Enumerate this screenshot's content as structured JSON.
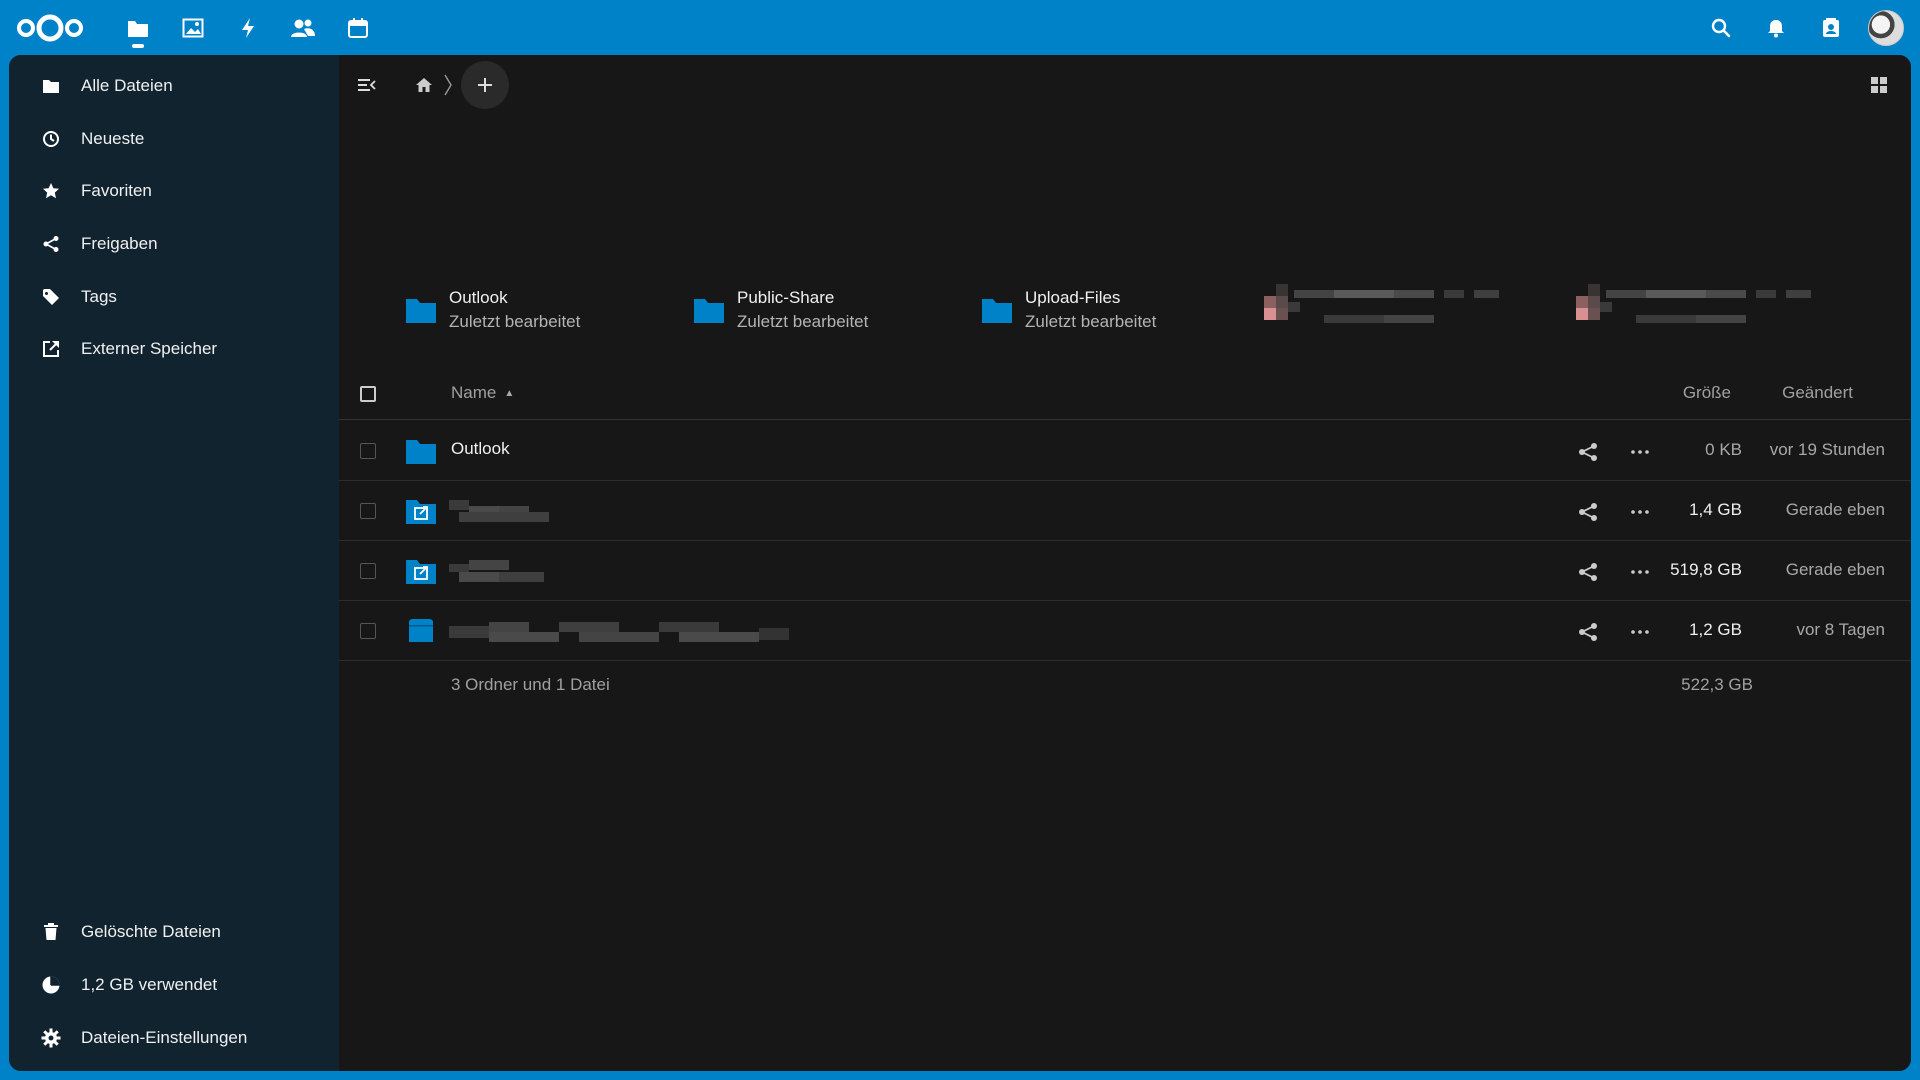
{
  "colors": {
    "primary": "#0082c9",
    "nav_bg": "#11232f",
    "main_bg": "#171717",
    "folder": "#0082c9"
  },
  "header": {
    "apps": [
      {
        "name": "files-icon",
        "active": true
      },
      {
        "name": "photos-icon"
      },
      {
        "name": "activity-icon"
      },
      {
        "name": "contacts-icon"
      },
      {
        "name": "calendar-icon"
      }
    ],
    "right_icons": [
      "search-icon",
      "bell-icon",
      "contacts-menu-icon"
    ]
  },
  "nav": {
    "items": [
      {
        "label": "Alle Dateien",
        "icon": "folder-icon"
      },
      {
        "label": "Neueste",
        "icon": "clock-icon"
      },
      {
        "label": "Favoriten",
        "icon": "star-icon"
      },
      {
        "label": "Freigaben",
        "icon": "share-icon"
      },
      {
        "label": "Tags",
        "icon": "tag-icon"
      },
      {
        "label": "Externer Speicher",
        "icon": "external-storage-icon"
      }
    ],
    "bottom": {
      "deleted": "Gelöschte Dateien",
      "quota": "1,2 GB verwendet",
      "settings": "Dateien-Einstellungen"
    }
  },
  "recommendations": [
    {
      "name": "Outlook",
      "sub": "Zuletzt bearbeitet"
    },
    {
      "name": "Public-Share",
      "sub": "Zuletzt bearbeitet"
    },
    {
      "name": "Upload-Files",
      "sub": "Zuletzt bearbeitet"
    }
  ],
  "table": {
    "headers": {
      "name": "Name",
      "size": "Größe",
      "modified": "Geändert"
    },
    "rows": [
      {
        "name": "Outlook",
        "size": "0 KB",
        "modified": "vor 19 Stunden",
        "type": "folder"
      },
      {
        "name": "",
        "size": "1,4 GB",
        "modified": "Gerade eben",
        "type": "external-folder"
      },
      {
        "name": "",
        "size": "519,8 GB",
        "modified": "Gerade eben",
        "type": "external-folder"
      },
      {
        "name": "",
        "size": "1,2 GB",
        "modified": "vor 8 Tagen",
        "type": "file"
      }
    ],
    "summary": "3 Ordner und 1 Datei",
    "total_size": "522,3 GB"
  }
}
